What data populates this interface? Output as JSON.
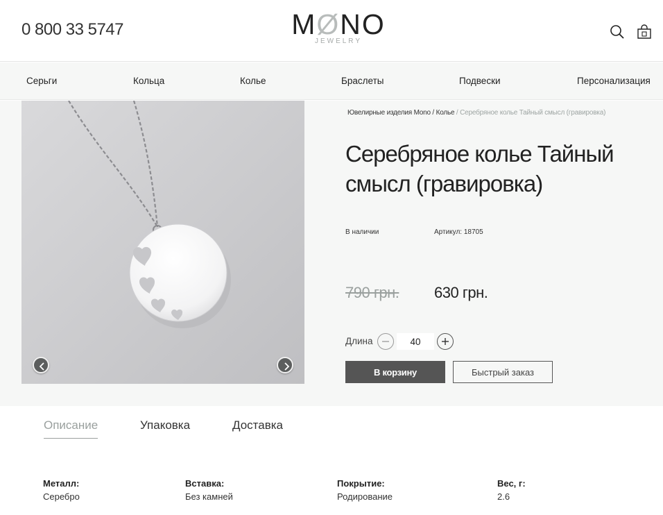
{
  "header": {
    "phone": "0 800 33 5747",
    "logo": {
      "left": "M",
      "slash": "Ø",
      "right": "NO",
      "sub": "JEWELRY"
    },
    "search_icon": "search-icon",
    "cart_icon": "shopping-bag-icon"
  },
  "nav": {
    "items": [
      {
        "label": "Серьги"
      },
      {
        "label": "Кольца"
      },
      {
        "label": "Колье"
      },
      {
        "label": "Браслеты"
      },
      {
        "label": "Подвески"
      },
      {
        "label": "Персонализация"
      }
    ]
  },
  "breadcrumb": {
    "home": "Ювелирные изделия Mono",
    "sep1": " / ",
    "category": "Колье",
    "sep2": " / ",
    "current": "Серебряное колье Тайный смысл (гравировка)"
  },
  "product": {
    "title": "Серебряное колье Тайный смысл (гравировка)",
    "stock": "В наличии",
    "sku": "Артикул: 18705",
    "old_price": "790 грн.",
    "new_price": "630 грн.",
    "length_label": "Длина",
    "length_value": "40",
    "add_to_cart": "В корзину",
    "quick_order": "Быстрый заказ"
  },
  "gallery": {
    "prev_icon": "chevron-left-icon",
    "next_icon": "chevron-right-icon"
  },
  "tabs": [
    {
      "label": "Описание",
      "active": true
    },
    {
      "label": "Упаковка",
      "active": false
    },
    {
      "label": "Доставка",
      "active": false
    }
  ],
  "specs": [
    {
      "label": "Металл:",
      "value": "Серебро"
    },
    {
      "label": "Вставка:",
      "value": "Без камней"
    },
    {
      "label": "Покрытие:",
      "value": "Родирование"
    },
    {
      "label": "Вес, г:",
      "value": "2.6"
    }
  ],
  "colors": {
    "accent_gray": "#555555",
    "muted": "#9aa09e",
    "panel_bg": "#f6f7f6"
  }
}
